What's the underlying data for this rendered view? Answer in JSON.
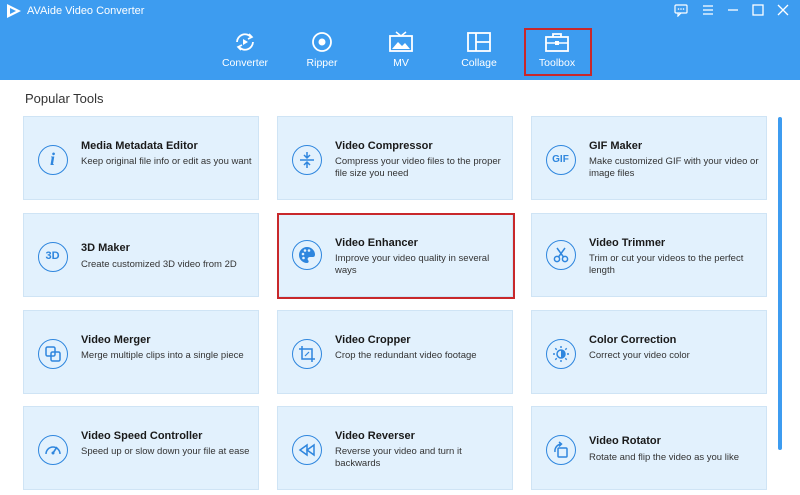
{
  "app": {
    "title": "AVAide Video Converter"
  },
  "nav": {
    "tabs": [
      {
        "label": "Converter",
        "icon": "converter-icon"
      },
      {
        "label": "Ripper",
        "icon": "ripper-icon"
      },
      {
        "label": "MV",
        "icon": "mv-icon"
      },
      {
        "label": "Collage",
        "icon": "collage-icon"
      },
      {
        "label": "Toolbox",
        "icon": "toolbox-icon",
        "active": true
      }
    ]
  },
  "section": {
    "title": "Popular Tools"
  },
  "tools": [
    {
      "title": "Media Metadata Editor",
      "desc": "Keep original file info or edit as you want",
      "icon": "info-icon",
      "icon_text": "i"
    },
    {
      "title": "Video Compressor",
      "desc": "Compress your video files to the proper file size you need",
      "icon": "compress-icon"
    },
    {
      "title": "GIF Maker",
      "desc": "Make customized GIF with your video or image files",
      "icon": "gif-icon",
      "icon_text": "GIF"
    },
    {
      "title": "3D Maker",
      "desc": "Create customized 3D video from 2D",
      "icon": "3d-icon",
      "icon_text": "3D"
    },
    {
      "title": "Video Enhancer",
      "desc": "Improve your video quality in several ways",
      "icon": "palette-icon",
      "highlighted": true
    },
    {
      "title": "Video Trimmer",
      "desc": "Trim or cut your videos to the perfect length",
      "icon": "scissors-icon"
    },
    {
      "title": "Video Merger",
      "desc": "Merge multiple clips into a single piece",
      "icon": "merge-icon"
    },
    {
      "title": "Video Cropper",
      "desc": "Crop the redundant video footage",
      "icon": "crop-icon"
    },
    {
      "title": "Color Correction",
      "desc": "Correct your video color",
      "icon": "color-correction-icon"
    },
    {
      "title": "Video Speed Controller",
      "desc": "Speed up or slow down your file at ease",
      "icon": "speedometer-icon"
    },
    {
      "title": "Video Reverser",
      "desc": "Reverse your video and turn it backwards",
      "icon": "rewind-icon"
    },
    {
      "title": "Video Rotator",
      "desc": "Rotate and flip the video as you like",
      "icon": "rotate-icon"
    }
  ],
  "colors": {
    "header": "#3d9cf0",
    "card": "#e2f1fd",
    "accent": "#2e86de",
    "highlight": "#c8282b"
  }
}
